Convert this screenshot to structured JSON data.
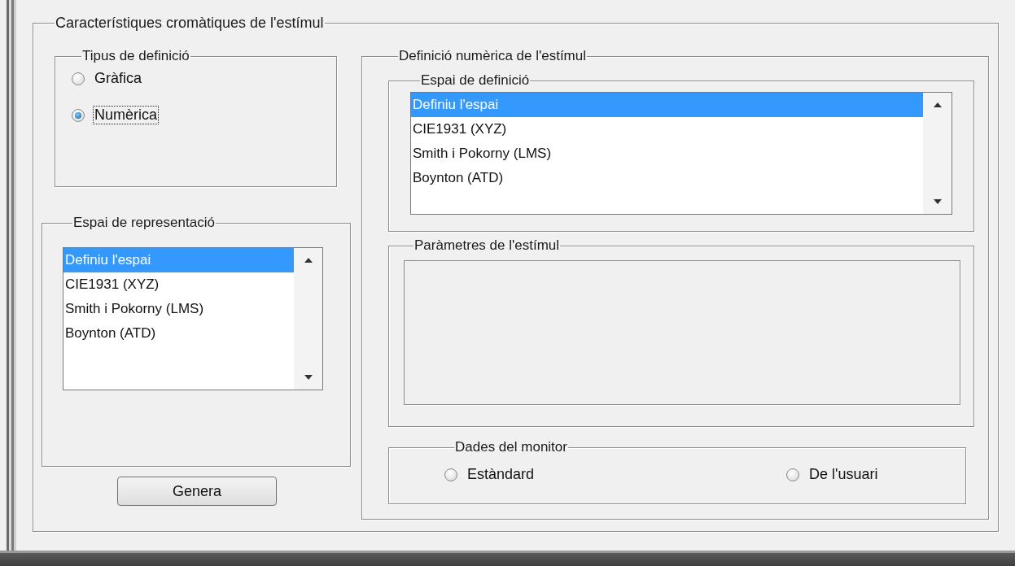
{
  "group": {
    "title": "Característiques cromàtiques de l'estímul"
  },
  "definition_type": {
    "title": "Tipus de definició",
    "options": [
      {
        "label": "Gràfica",
        "selected": false,
        "focused": false
      },
      {
        "label": "Numèrica",
        "selected": true,
        "focused": true
      }
    ]
  },
  "representation_space": {
    "title": "Espai de representació",
    "items": [
      {
        "label": "Definiu l'espai",
        "selected": true
      },
      {
        "label": "CIE1931 (XYZ)",
        "selected": false
      },
      {
        "label": "Smith i Pokorny (LMS)",
        "selected": false
      },
      {
        "label": "Boynton (ATD)",
        "selected": false
      }
    ]
  },
  "generate_button": {
    "label": "Genera"
  },
  "numeric_definition": {
    "title": "Definició numèrica de l'estímul",
    "definition_space": {
      "title": "Espai de definició",
      "items": [
        {
          "label": "Definiu l'espai",
          "selected": true
        },
        {
          "label": "CIE1931 (XYZ)",
          "selected": false
        },
        {
          "label": "Smith i Pokorny (LMS)",
          "selected": false
        },
        {
          "label": "Boynton (ATD)",
          "selected": false
        }
      ]
    },
    "stimulus_parameters": {
      "title": "Paràmetres de l'estímul"
    },
    "monitor_data": {
      "title": "Dades del monitor",
      "options": [
        {
          "label": "Estàndard",
          "selected": false,
          "focused": false
        },
        {
          "label": "De l'usuari",
          "selected": false,
          "focused": false
        }
      ]
    }
  }
}
